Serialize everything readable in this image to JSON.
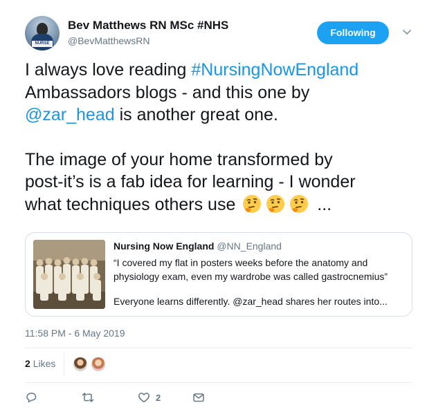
{
  "author": {
    "display_name": "Bev Matthews RN MSc #NHS",
    "handle": "@BevMatthewsRN",
    "avatar_icon": "profile-photo-nurse",
    "avatar_badge": "NURSE"
  },
  "follow": {
    "label": "Following",
    "color": "#1da1f2"
  },
  "tweet": {
    "line1_pre": "I always love reading ",
    "hashtag": "#NursingNowEngland",
    "line2": "Ambassadors blogs - and this one by",
    "mention": "@zar_head",
    "line3_post": " is another great one.",
    "para2_line1": "The image of your home transformed by",
    "para2_line2": "post-it’s is a fab idea for learning - I wonder",
    "para2_line3": "what techniques others use",
    "ellipsis": "...",
    "emojis": [
      "thinking-face-icon",
      "thinking-face-icon",
      "thinking-face-icon"
    ]
  },
  "quote": {
    "name": "Nursing Now England",
    "handle": "@NN_England",
    "text_line1": "“I covered my flat in posters weeks before the anatomy and",
    "text_line2": "physiology exam, even my wardrobe was called gastrocnemius”",
    "text_line3": "Everyone learns differently. @zar_head shares her routes into..."
  },
  "timestamp": "11:58 PM - 6 May 2019",
  "likes": {
    "count": "2",
    "label": "Likes"
  },
  "actions": {
    "reply_icon": "reply-icon",
    "retweet_icon": "retweet-icon",
    "like_icon": "heart-icon",
    "like_count": "2",
    "dm_icon": "envelope-icon"
  },
  "colors": {
    "link": "#1b95e0",
    "secondary_text": "#657786",
    "accent": "#1da1f2"
  }
}
